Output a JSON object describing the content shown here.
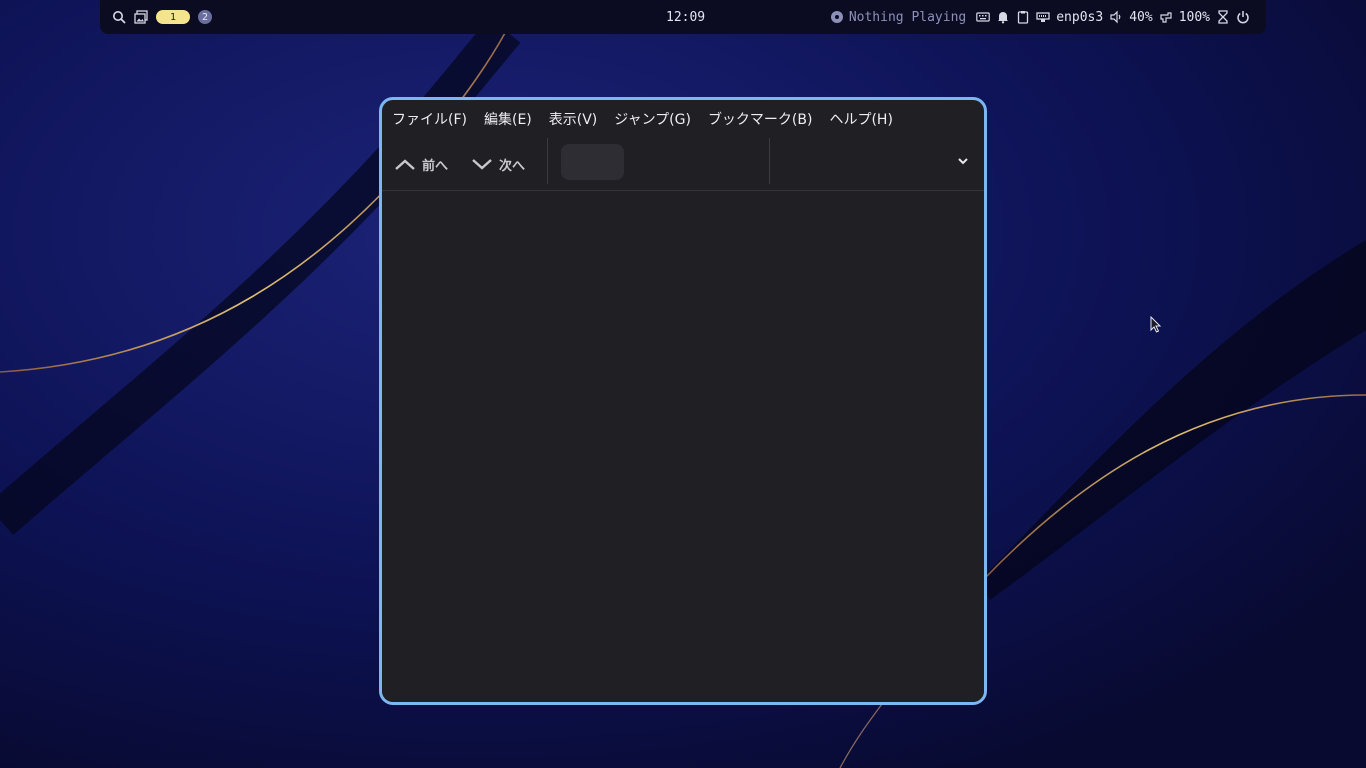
{
  "topbar": {
    "workspaces": [
      {
        "label": "1",
        "active": true
      },
      {
        "label": "2",
        "active": false
      }
    ],
    "clock": "12:09",
    "media": "Nothing Playing",
    "network": "enp0s3",
    "volume": "40%",
    "battery": "100%"
  },
  "window": {
    "menus": [
      "ファイル(F)",
      "編集(E)",
      "表示(V)",
      "ジャンプ(G)",
      "ブックマーク(B)",
      "ヘルプ(H)"
    ],
    "toolbar": {
      "prev_label": "前へ",
      "next_label": "次へ",
      "page_value": ""
    },
    "border_color": "#7cb6f3"
  },
  "colors": {
    "accent": "#7cb6f3",
    "workspace_active": "#f5e48e",
    "workspace_inactive": "#6a6e9e",
    "desktop": "#090c3a"
  },
  "icons": {
    "topbar_left": [
      "search-icon",
      "gallery-icon"
    ],
    "topbar_right": [
      "media-icon",
      "keyboard-icon",
      "bell-icon",
      "clipboard-icon",
      "ethernet-icon",
      "volume-icon",
      "battery-icon",
      "hourglass-icon",
      "power-icon"
    ],
    "toolbar": [
      "chevron-up-icon",
      "chevron-down-icon",
      "dropdown-arrow-icon"
    ]
  }
}
